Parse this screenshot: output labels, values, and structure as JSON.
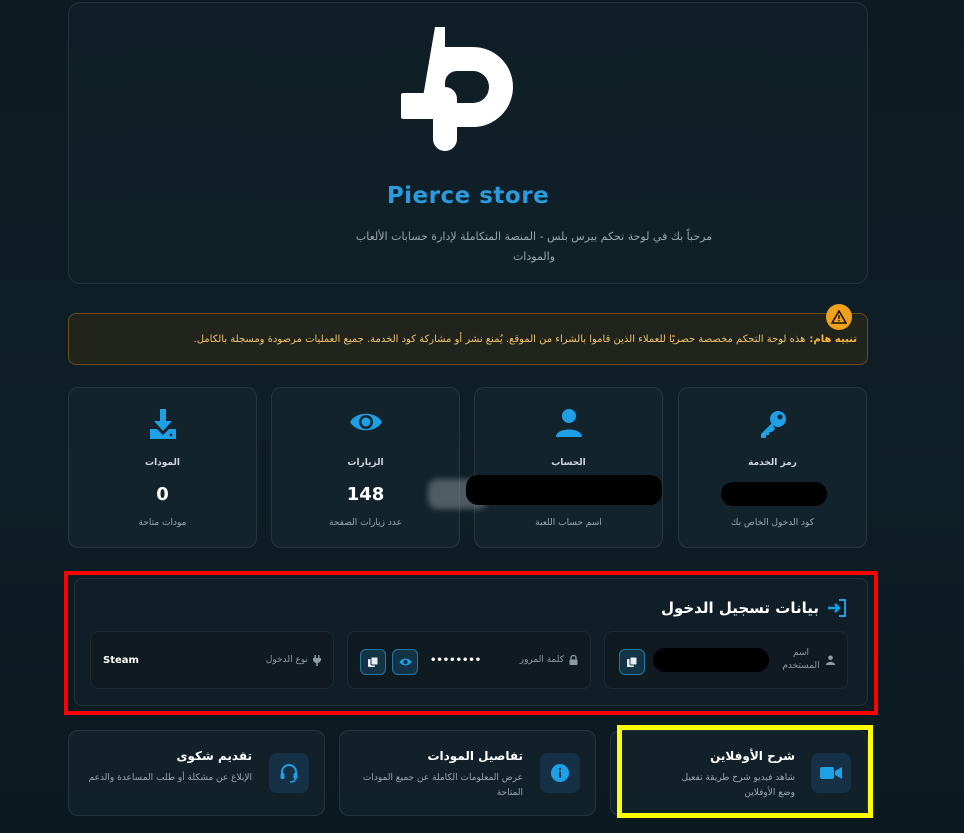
{
  "header": {
    "brand": "Pierce store",
    "welcome": "مرحباً بك في لوحة تحكم بيرس بلس - المنصة المتكاملة لإدارة حسابات الألعاب والمودات"
  },
  "warning": {
    "label": "تنبيه هام:",
    "text": "هذه لوحة التحكم مخصصة حصريًا للعملاء الذين قاموا بالشراء من الموقع. يُمنع نشر أو مشاركة كود الخدمة. جميع العمليات مرصودة ومسجلة بالكامل."
  },
  "stats": [
    {
      "icon": "key-icon",
      "title": "رمز الخدمة",
      "value": "",
      "subtitle": "كود الدخول الخاص بك"
    },
    {
      "icon": "user-icon",
      "title": "الحساب",
      "value": "",
      "subtitle": "اسم حساب اللعبة"
    },
    {
      "icon": "eye-icon",
      "title": "الزيارات",
      "value": "148",
      "subtitle": "عدد زيارات الصفحة"
    },
    {
      "icon": "download-icon",
      "title": "المودات",
      "value": "0",
      "subtitle": "مودات متاحة"
    }
  ],
  "login": {
    "title": "بيانات تسجيل الدخول",
    "username_label": "اسم المستخدم",
    "password_label": "كلمة المرور",
    "password_value": "••••••••",
    "login_type_label": "نوع الدخول",
    "login_type_value": "Steam"
  },
  "cards": [
    {
      "icon": "video-icon",
      "title": "شرح الأوفلاين",
      "desc": "شاهد فيديو شرح طريقة تفعيل وضع الأوفلاين"
    },
    {
      "icon": "info-icon",
      "title": "تفاصيل المودات",
      "desc": "عرض المعلومات الكاملة عن جميع المودات المتاحة"
    },
    {
      "icon": "headset-icon",
      "title": "تقديم شكوى",
      "desc": "الإبلاغ عن مشكلة أو طلب المساعدة والدعم"
    }
  ],
  "colors": {
    "accent": "#2a9bdc",
    "warning": "#f0a11c",
    "highlight_red": "#ff0000",
    "highlight_yellow": "#ffff00"
  }
}
